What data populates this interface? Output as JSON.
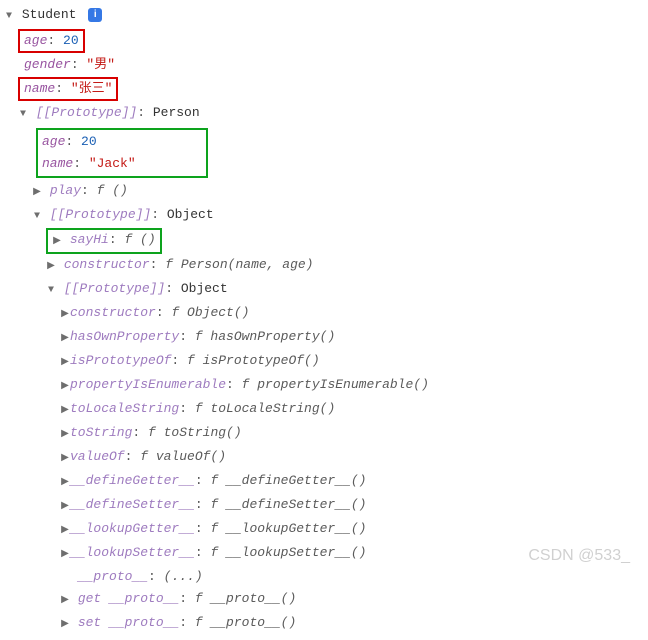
{
  "root": {
    "type": "Student"
  },
  "own": {
    "age_key": "age",
    "age_val": "20",
    "gender_key": "gender",
    "gender_val": "\"男\"",
    "name_key": "name",
    "name_val": "\"张三\""
  },
  "proto1": {
    "label": "[[Prototype]]",
    "type": "Person",
    "age_key": "age",
    "age_val": "20",
    "name_key": "name",
    "name_val": "\"Jack\"",
    "play_key": "play",
    "play_val": "f ()"
  },
  "proto2": {
    "label": "[[Prototype]]",
    "type": "Object",
    "sayHi_key": "sayHi",
    "sayHi_val": "f ()",
    "constructor_key": "constructor",
    "constructor_val": "f Person(name, age)"
  },
  "proto3": {
    "label": "[[Prototype]]",
    "type": "Object",
    "items": [
      {
        "key": "constructor",
        "val": "f Object()"
      },
      {
        "key": "hasOwnProperty",
        "val": "f hasOwnProperty()"
      },
      {
        "key": "isPrototypeOf",
        "val": "f isPrototypeOf()"
      },
      {
        "key": "propertyIsEnumerable",
        "val": "f propertyIsEnumerable()"
      },
      {
        "key": "toLocaleString",
        "val": "f toLocaleString()"
      },
      {
        "key": "toString",
        "val": "f toString()"
      },
      {
        "key": "valueOf",
        "val": "f valueOf()"
      },
      {
        "key": "__defineGetter__",
        "val": "f __defineGetter__()"
      },
      {
        "key": "__defineSetter__",
        "val": "f __defineSetter__()"
      },
      {
        "key": "__lookupGetter__",
        "val": "f __lookupGetter__()"
      },
      {
        "key": "__lookupSetter__",
        "val": "f __lookupSetter__()"
      }
    ],
    "proto_key": "__proto__",
    "proto_val": "(...)",
    "get_proto_key": "get __proto__",
    "get_proto_val": "f __proto__()",
    "set_proto_key": "set __proto__",
    "set_proto_val": "f __proto__()"
  },
  "watermark": "CSDN @533_",
  "info_glyph": "i",
  "colon": ": "
}
